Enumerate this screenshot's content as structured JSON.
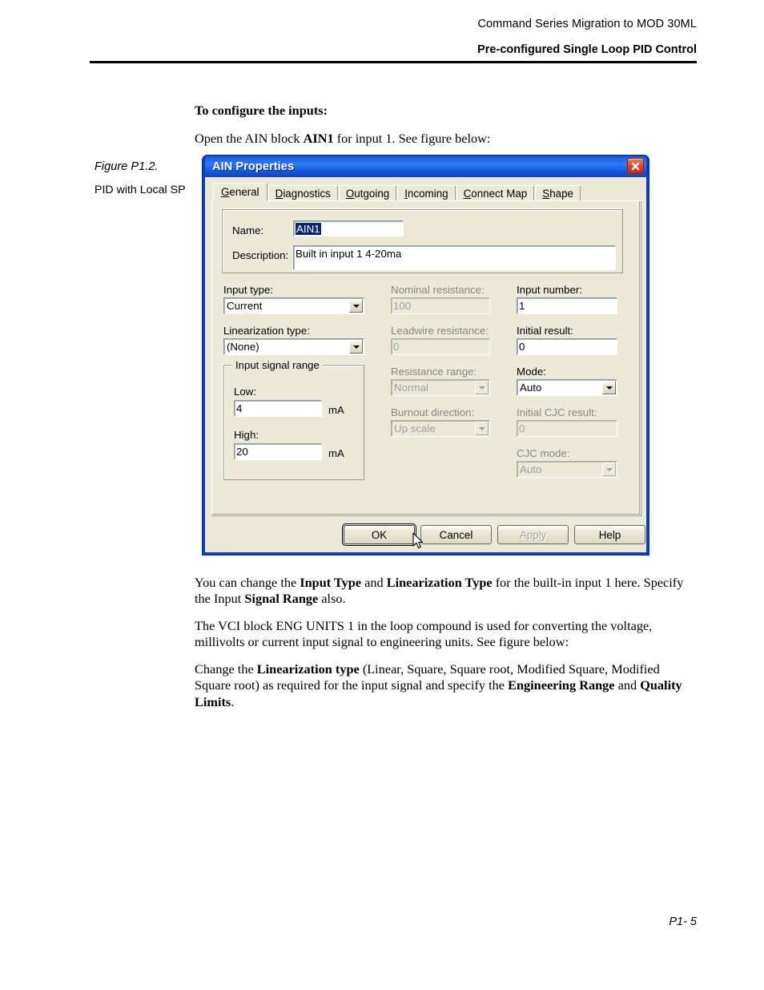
{
  "page": {
    "header_line1": "Command Series Migration to MOD 30ML",
    "header_line2": "Pre-configured Single Loop PID Control",
    "footer": "P1- 5"
  },
  "figure_caption": {
    "title": "Figure P1.2.",
    "subtitle": "PID with Local SP"
  },
  "intro": {
    "heading": "To configure the inputs:",
    "line_pre": "Open the AIN block ",
    "line_bold": "AIN1",
    "line_post": " for input 1. See figure below:"
  },
  "paragraphs": {
    "p1_a": "You can change the ",
    "p1_b1": "Input Type",
    "p1_c": " and ",
    "p1_b2": "Linearization Type",
    "p1_d": " for the built-in input 1 here. Specify the Input ",
    "p1_b3": "Signal Range",
    "p1_e": " also.",
    "p2": "The VCI block ENG UNITS 1 in the loop compound is used for converting the voltage, millivolts or current input signal to engineering units. See figure below:",
    "p3_a": "Change the ",
    "p3_b1": "Linearization type",
    "p3_c": " (Linear, Square, Square root, Modified Square, Modified Square root) as required for the input signal and specify the ",
    "p3_b2": "Engineering Range",
    "p3_d": " and ",
    "p3_b3": "Quality Limits",
    "p3_e": "."
  },
  "dialog": {
    "title": "AIN Properties",
    "close_label": "Close",
    "tabs": [
      {
        "label_a": "G",
        "label_b": "eneral",
        "active": true
      },
      {
        "label_a": "D",
        "label_b": "iagnostics",
        "active": false
      },
      {
        "label_a": "O",
        "label_b": "utgoing",
        "active": false
      },
      {
        "label_a": "I",
        "label_b": "ncoming",
        "active": false
      },
      {
        "label_a": "C",
        "label_b": "onnect Map",
        "active": false
      },
      {
        "label_a": "S",
        "label_b": "hape",
        "active": false
      }
    ],
    "tab_labels_full": [
      "General",
      "Diagnostics",
      "Outgoing",
      "Incoming",
      "Connect Map",
      "Shape"
    ],
    "identity": {
      "name_label": "Name:",
      "name_value": "AIN1",
      "name_selected": true,
      "description_label": "Description:",
      "description_value": "Built in input 1  4-20ma"
    },
    "fields": {
      "input_type_label": "Input type:",
      "input_type_value": "Current",
      "input_type_disabled": false,
      "linearization_type_label": "Linearization type:",
      "linearization_type_value": "(None)",
      "linearization_type_disabled": false,
      "signal_range_legend": "Input signal range",
      "low_label": "Low:",
      "low_value": "4",
      "low_unit": "mA",
      "high_label": "High:",
      "high_value": "20",
      "high_unit": "mA",
      "nominal_resistance_label": "Nominal resistance:",
      "nominal_resistance_value": "100",
      "nominal_resistance_disabled": true,
      "leadwire_resistance_label": "Leadwire resistance:",
      "leadwire_resistance_value": "0",
      "leadwire_resistance_disabled": true,
      "resistance_range_label": "Resistance range:",
      "resistance_range_value": "Normal",
      "resistance_range_disabled": true,
      "burnout_direction_label": "Burnout direction:",
      "burnout_direction_value": "Up scale",
      "burnout_direction_disabled": true,
      "input_number_label": "Input number:",
      "input_number_value": "1",
      "input_number_disabled": false,
      "initial_result_label": "Initial result:",
      "initial_result_value": "0",
      "initial_result_disabled": false,
      "mode_label": "Mode:",
      "mode_value": "Auto",
      "mode_disabled": false,
      "initial_cjc_result_label": "Initial CJC result:",
      "initial_cjc_result_value": "0",
      "initial_cjc_result_disabled": true,
      "cjc_mode_label": "CJC mode:",
      "cjc_mode_value": "Auto",
      "cjc_mode_disabled": true
    },
    "buttons": {
      "ok": "OK",
      "cancel": "Cancel",
      "apply": "Apply",
      "apply_disabled": true,
      "help": "Help"
    }
  },
  "colors": {
    "title_bar_blue": "#0A4AD0",
    "window_frame_blue": "#0A3FC4",
    "dialog_face": "#ECE9D8",
    "close_red": "#E2492B",
    "selection_blue": "#0A246A"
  }
}
